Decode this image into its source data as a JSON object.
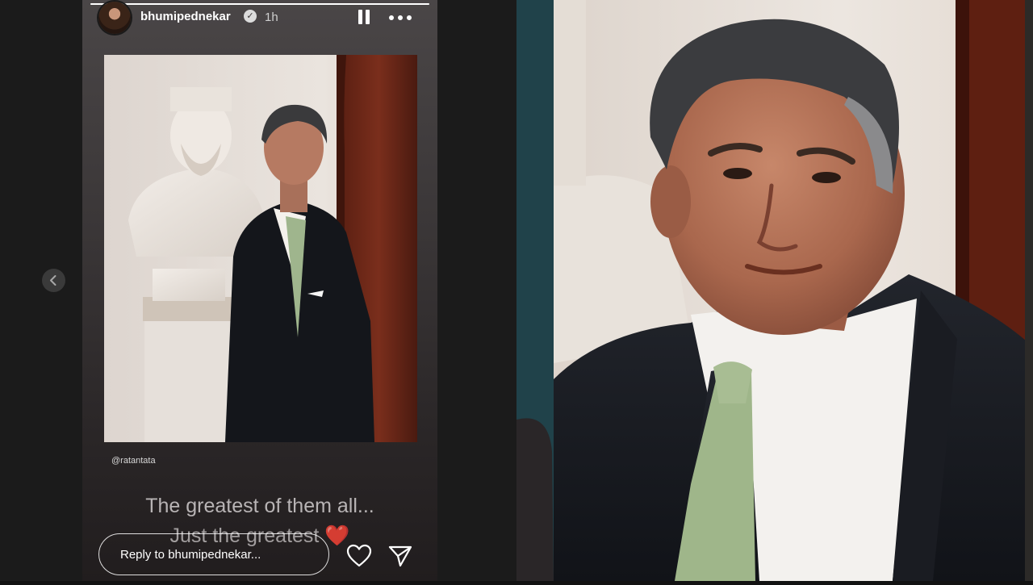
{
  "story": {
    "username": "bhumipednekar",
    "time_ago": "1h",
    "verified_icon": "verified-check-icon",
    "mention": "@ratantata",
    "caption_line1": "The greatest of them all...",
    "caption_line2": "Just the greatest",
    "caption_emoji": "❤️",
    "progress": 1.0
  },
  "reply": {
    "placeholder": "Reply to bhumipednekar..."
  },
  "icons": {
    "pause": "pause-icon",
    "more": "more-options-icon",
    "like": "heart-icon",
    "share": "send-icon",
    "previous": "chevron-left-icon"
  },
  "colors": {
    "card_bg": "#3a3637",
    "teal_strip": "#20424a",
    "heart_red": "#d32b2b"
  }
}
